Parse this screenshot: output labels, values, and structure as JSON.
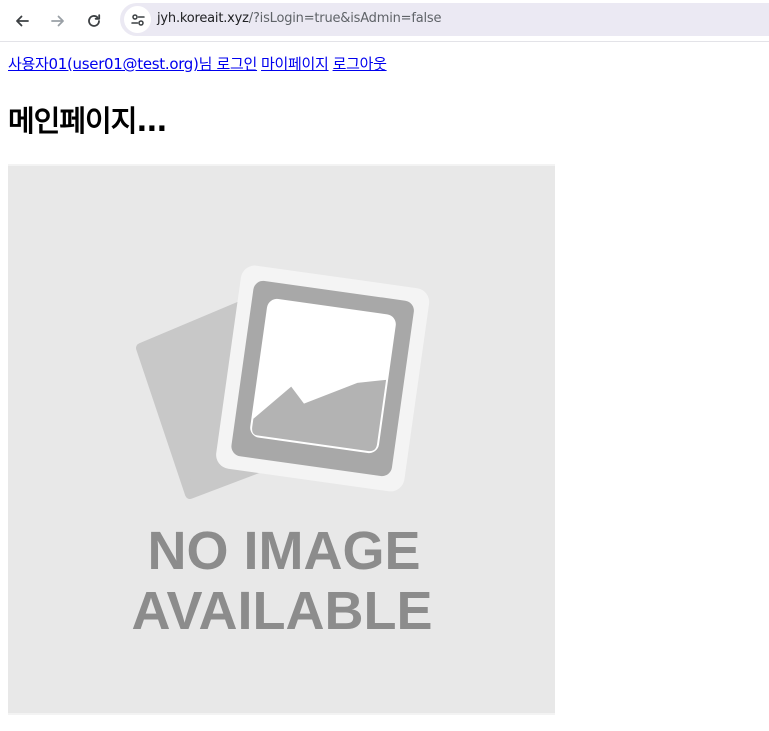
{
  "browser": {
    "url_host": "jyh.koreait.xyz",
    "url_rest": "/?isLogin=true&isAdmin=false",
    "icons": {
      "back": "arrow-left-icon",
      "forward": "arrow-right-icon",
      "reload": "reload-icon",
      "site_info": "site-settings-icon"
    }
  },
  "header": {
    "user_link": "사용자01(user01@test.org)님 로그인",
    "mypage_link": "마이페이지",
    "logout_link": "로그아웃"
  },
  "main": {
    "title": "메인페이지...",
    "placeholder_image": {
      "line1": "NO IMAGE",
      "line2": "AVAILABLE"
    }
  },
  "colors": {
    "link": "#0000ee",
    "omnibox_bg": "#ebe9f3",
    "placeholder_bg": "#e8e8e8",
    "placeholder_text": "#8c8c8c"
  }
}
